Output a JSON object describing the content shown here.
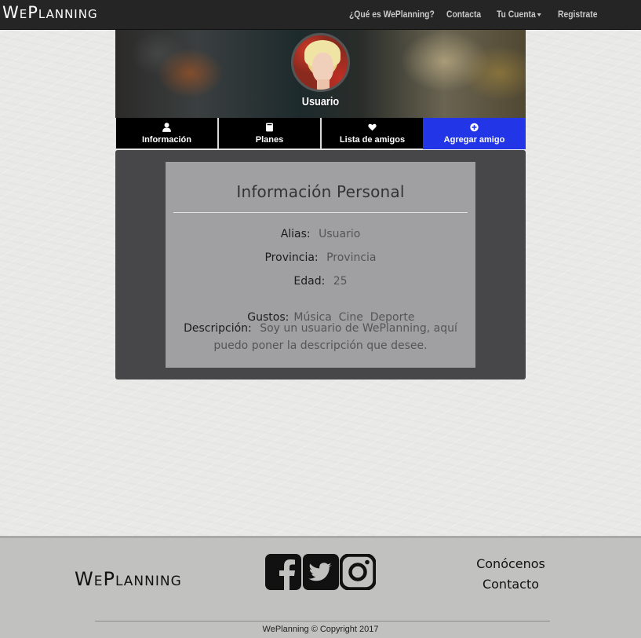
{
  "nav": {
    "brand": "WePlanning",
    "links": [
      "¿Qué es WePlanning?",
      "Contacta",
      "Tu Cuenta",
      "Registrate"
    ]
  },
  "profile": {
    "username": "Usuario"
  },
  "tabs": [
    {
      "label": "Información",
      "icon": "user-icon"
    },
    {
      "label": "Planes",
      "icon": "book-icon"
    },
    {
      "label": "Lista de amigos",
      "icon": "heart-icon"
    },
    {
      "label": "Agregar amigo",
      "icon": "plus-circle-icon",
      "active": true
    }
  ],
  "info": {
    "title": "Información Personal",
    "alias_label": "Alias:",
    "alias_value": "Usuario",
    "provincia_label": "Provincia:",
    "provincia_value": "Provincia",
    "edad_label": "Edad:",
    "edad_value": "25",
    "gustos_label": "Gustos:",
    "gustos_value": "Música  Cine  Deporte",
    "descripcion_label": "Descripción:",
    "descripcion_value": "Soy un usuario de WePlanning, aquí puedo poner la descripción que desee."
  },
  "footer": {
    "brand": "WePlanning",
    "social": [
      "facebook-icon",
      "twitter-icon",
      "instagram-icon"
    ],
    "links": [
      "Conócenos",
      "Contacto"
    ],
    "copyright": "WePlanning © Copyright 2017"
  },
  "colors": {
    "navbar": "#252525",
    "active_tab": "#2236e8",
    "panel": "#474649",
    "card": "#a0a0a3",
    "footer": "#c1c1bf"
  }
}
